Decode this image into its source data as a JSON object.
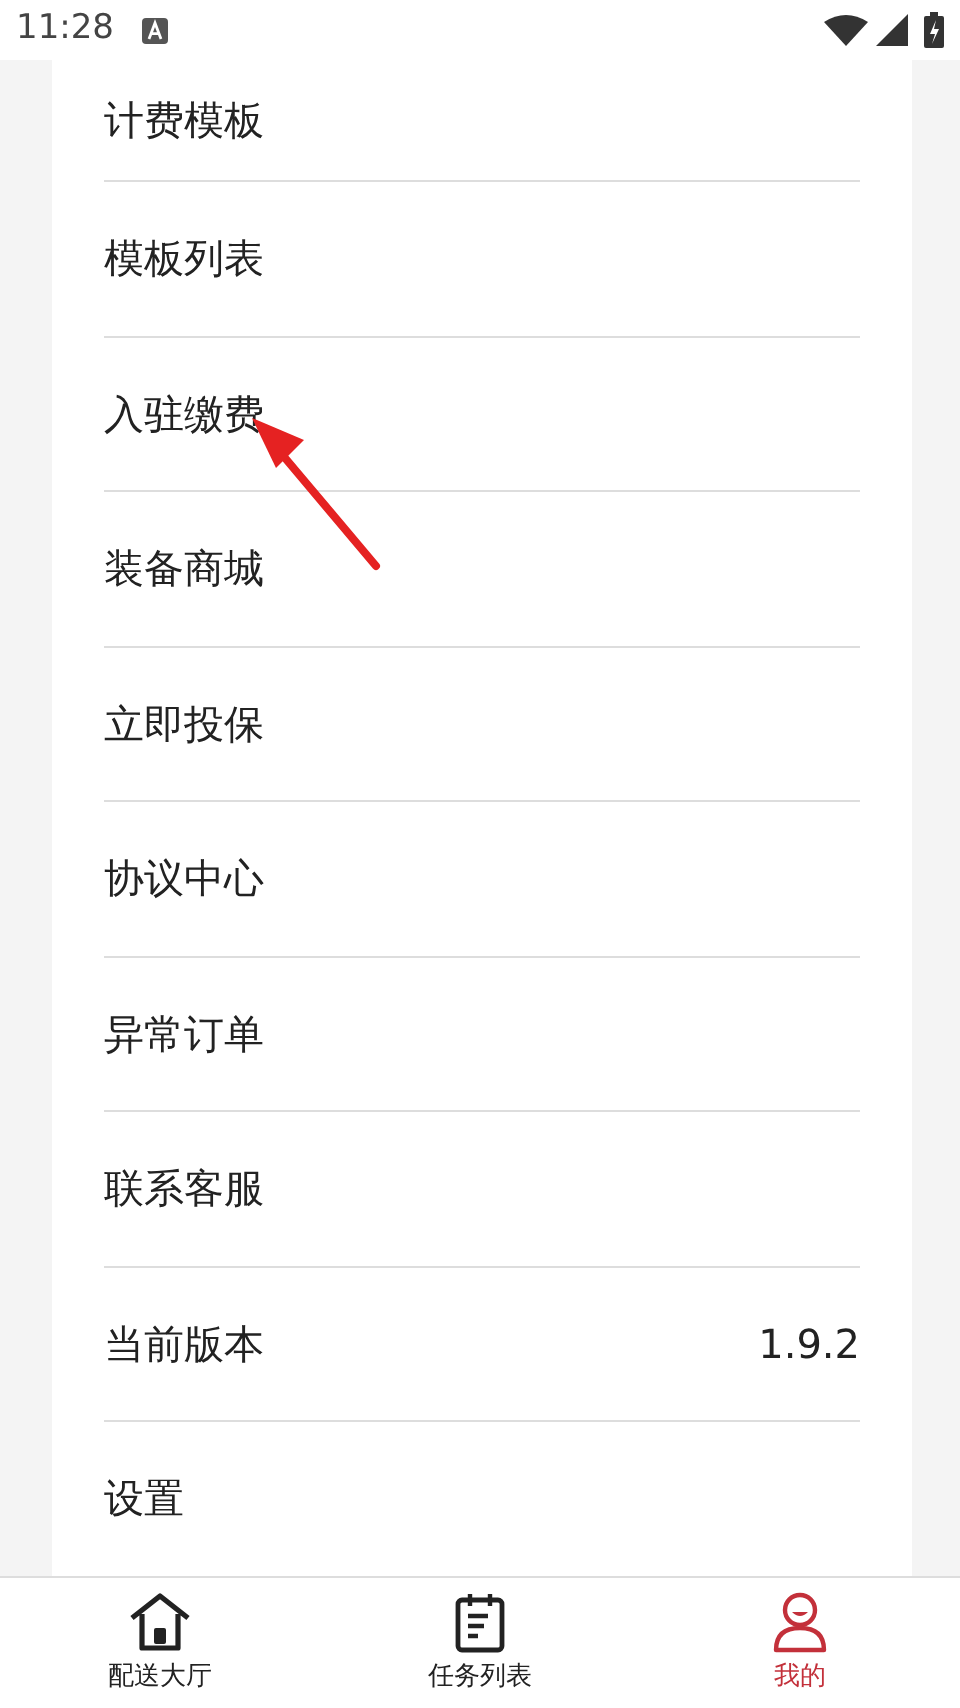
{
  "status_bar": {
    "time": "11:28"
  },
  "menu": [
    {
      "label": "计费模板"
    },
    {
      "label": "模板列表"
    },
    {
      "label": "入驻缴费"
    },
    {
      "label": "装备商城"
    },
    {
      "label": "立即投保"
    },
    {
      "label": "协议中心"
    },
    {
      "label": "异常订单"
    },
    {
      "label": "联系客服"
    },
    {
      "label": "当前版本",
      "value": "1.9.2"
    },
    {
      "label": "设置"
    }
  ],
  "bottom_nav": [
    {
      "label": "配送大厅",
      "selected": false
    },
    {
      "label": "任务列表",
      "selected": false
    },
    {
      "label": "我的",
      "selected": true
    }
  ]
}
